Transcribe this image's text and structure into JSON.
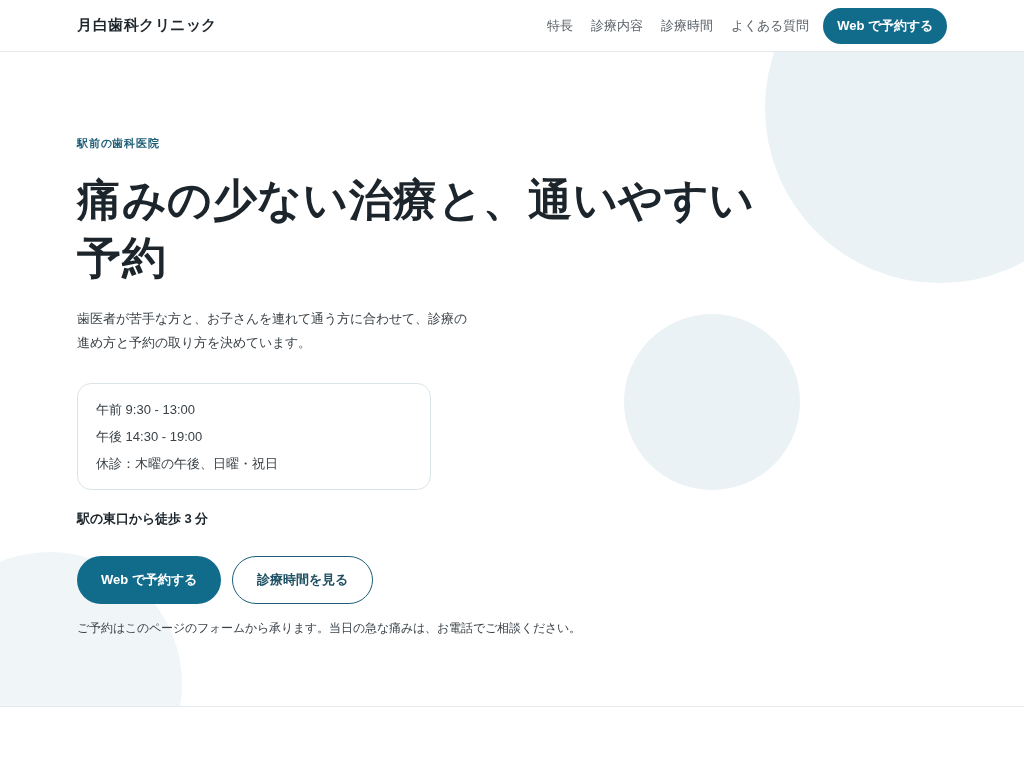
{
  "header": {
    "logo": "月白歯科クリニック",
    "nav": [
      "特長",
      "診療内容",
      "診療時間",
      "よくある質問"
    ],
    "cta": "Web で予約する"
  },
  "hero": {
    "eyebrow": "駅前の歯科医院",
    "title": "痛みの少ない治療と、通いやすい予約",
    "lead": "歯医者が苦手な方と、お子さんを連れて通う方に合わせて、診療の進め方と予約の取り方を決めています。",
    "hours": [
      "午前 9:30 - 13:00",
      "午後 14:30 - 19:00",
      "休診：木曜の午後、日曜・祝日"
    ],
    "access": "駅の東口から徒歩 3 分",
    "buttons": [
      {
        "kind": "primary",
        "label": "Web で予約する"
      },
      {
        "kind": "secondary",
        "label": "診療時間を見る"
      }
    ],
    "note": "ご予約はこのページのフォームから承ります。当日の急な痛みは、お電話でご相談ください。"
  }
}
